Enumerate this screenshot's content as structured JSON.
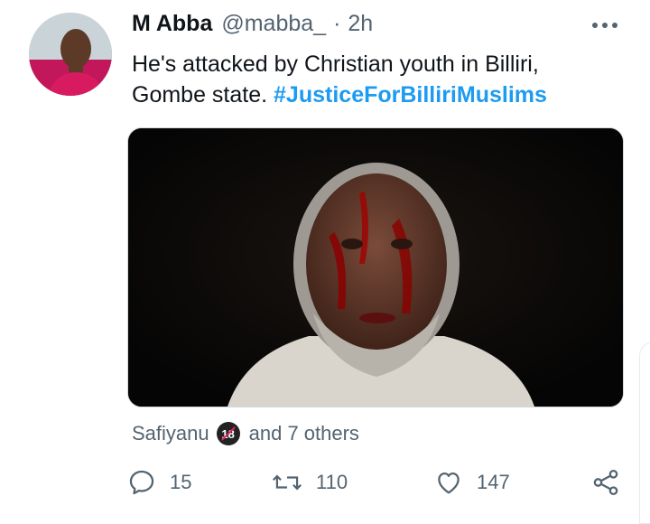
{
  "tweet": {
    "display_name": "M Abba",
    "handle": "@mabba_",
    "separator": "·",
    "time": "2h",
    "text_line1": "He's attacked by Christian youth in Billiri,",
    "text_line2_plain": "Gombe state. ",
    "hashtag": "#JusticeForBilliriMuslims"
  },
  "liked_by": {
    "user": "Safiyanu",
    "badge": "18",
    "others": "and 7 others"
  },
  "actions": {
    "replies": "15",
    "retweets": "110",
    "likes": "147"
  },
  "icons": [
    "more-horizontal-icon",
    "reply-icon",
    "retweet-icon",
    "like-icon",
    "share-icon"
  ],
  "colors": {
    "link": "#1d9bf0",
    "secondary": "#536471",
    "text": "#0f1419"
  }
}
